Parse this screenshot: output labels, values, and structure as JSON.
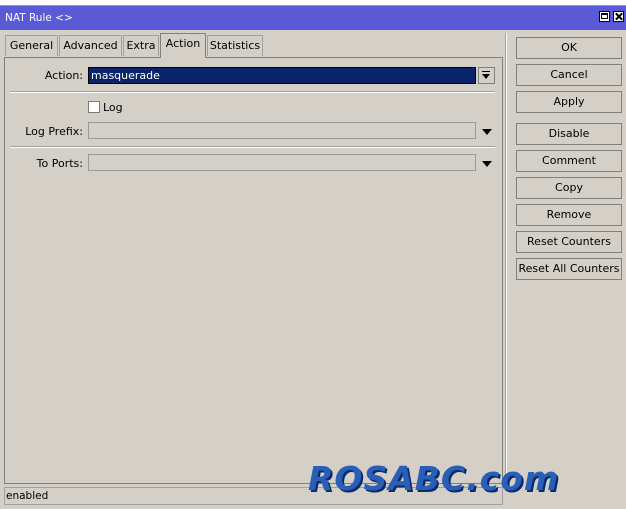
{
  "window": {
    "title": "NAT Rule <>"
  },
  "tabs": [
    {
      "label": "General"
    },
    {
      "label": "Advanced"
    },
    {
      "label": "Extra"
    },
    {
      "label": "Action",
      "active": true
    },
    {
      "label": "Statistics"
    }
  ],
  "form": {
    "action": {
      "label": "Action:",
      "value": "masquerade"
    },
    "log": {
      "label": "Log",
      "checked": false
    },
    "log_prefix": {
      "label": "Log Prefix:",
      "value": ""
    },
    "to_ports": {
      "label": "To Ports:",
      "value": ""
    }
  },
  "buttons": [
    "OK",
    "Cancel",
    "Apply",
    "Disable",
    "Comment",
    "Copy",
    "Remove",
    "Reset Counters",
    "Reset All Counters"
  ],
  "status": "enabled",
  "watermark": "ROSABC.com",
  "colors": {
    "titlebar": "#5a5ad6",
    "selection": "#0a246a",
    "background": "#d4d0c8"
  }
}
